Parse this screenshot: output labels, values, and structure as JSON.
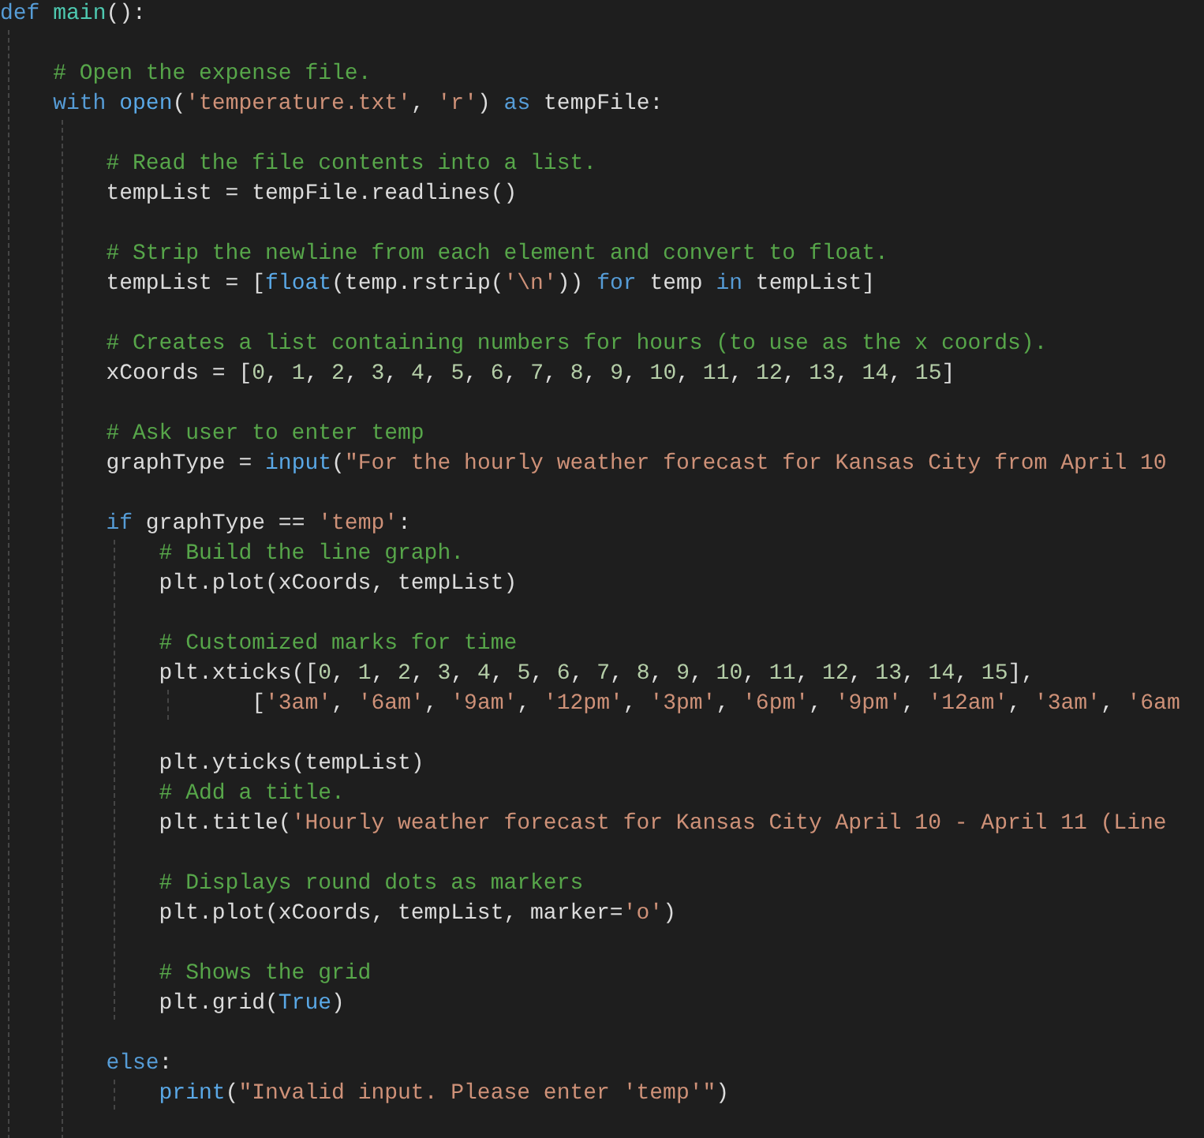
{
  "editor": {
    "lines": [
      {
        "kind": "code",
        "tokens": [
          {
            "kind": "keyword",
            "text": "def "
          },
          {
            "kind": "name",
            "text": "main"
          },
          {
            "kind": "plain",
            "text": "():"
          }
        ],
        "children": [
          {
            "kind": "blank"
          },
          {
            "kind": "code",
            "tokens": [
              {
                "kind": "comment",
                "text": "# Open the expense file."
              }
            ]
          },
          {
            "kind": "code",
            "tokens": [
              {
                "kind": "keyword",
                "text": "with "
              },
              {
                "kind": "builtin",
                "text": "open"
              },
              {
                "kind": "plain",
                "text": "("
              },
              {
                "kind": "string",
                "text": "'temperature.txt'"
              },
              {
                "kind": "plain",
                "text": ", "
              },
              {
                "kind": "string",
                "text": "'r'"
              },
              {
                "kind": "plain",
                "text": ") "
              },
              {
                "kind": "keyword",
                "text": "as"
              },
              {
                "kind": "plain",
                "text": " tempFile:"
              }
            ],
            "children": [
              {
                "kind": "blank"
              },
              {
                "kind": "code",
                "tokens": [
                  {
                    "kind": "comment",
                    "text": "# Read the file contents into a list."
                  }
                ]
              },
              {
                "kind": "code",
                "tokens": [
                  {
                    "kind": "plain",
                    "text": "tempList = tempFile.readlines()"
                  }
                ]
              },
              {
                "kind": "blank"
              },
              {
                "kind": "code",
                "tokens": [
                  {
                    "kind": "comment",
                    "text": "# Strip the newline from each element and convert to float."
                  }
                ]
              },
              {
                "kind": "code",
                "tokens": [
                  {
                    "kind": "plain",
                    "text": "tempList = ["
                  },
                  {
                    "kind": "builtin",
                    "text": "float"
                  },
                  {
                    "kind": "plain",
                    "text": "(temp.rstrip("
                  },
                  {
                    "kind": "string",
                    "text": "'\\n'"
                  },
                  {
                    "kind": "plain",
                    "text": ")) "
                  },
                  {
                    "kind": "keyword",
                    "text": "for"
                  },
                  {
                    "kind": "plain",
                    "text": " temp "
                  },
                  {
                    "kind": "keyword",
                    "text": "in"
                  },
                  {
                    "kind": "plain",
                    "text": " tempList]"
                  }
                ]
              },
              {
                "kind": "blank"
              },
              {
                "kind": "code",
                "tokens": [
                  {
                    "kind": "comment",
                    "text": "# Creates a list containing numbers for hours (to use as the x coords)."
                  }
                ]
              },
              {
                "kind": "code",
                "tokens": [
                  {
                    "kind": "plain",
                    "text": "xCoords = ["
                  },
                  {
                    "kind": "number",
                    "text": "0"
                  },
                  {
                    "kind": "plain",
                    "text": ", "
                  },
                  {
                    "kind": "number",
                    "text": "1"
                  },
                  {
                    "kind": "plain",
                    "text": ", "
                  },
                  {
                    "kind": "number",
                    "text": "2"
                  },
                  {
                    "kind": "plain",
                    "text": ", "
                  },
                  {
                    "kind": "number",
                    "text": "3"
                  },
                  {
                    "kind": "plain",
                    "text": ", "
                  },
                  {
                    "kind": "number",
                    "text": "4"
                  },
                  {
                    "kind": "plain",
                    "text": ", "
                  },
                  {
                    "kind": "number",
                    "text": "5"
                  },
                  {
                    "kind": "plain",
                    "text": ", "
                  },
                  {
                    "kind": "number",
                    "text": "6"
                  },
                  {
                    "kind": "plain",
                    "text": ", "
                  },
                  {
                    "kind": "number",
                    "text": "7"
                  },
                  {
                    "kind": "plain",
                    "text": ", "
                  },
                  {
                    "kind": "number",
                    "text": "8"
                  },
                  {
                    "kind": "plain",
                    "text": ", "
                  },
                  {
                    "kind": "number",
                    "text": "9"
                  },
                  {
                    "kind": "plain",
                    "text": ", "
                  },
                  {
                    "kind": "number",
                    "text": "10"
                  },
                  {
                    "kind": "plain",
                    "text": ", "
                  },
                  {
                    "kind": "number",
                    "text": "11"
                  },
                  {
                    "kind": "plain",
                    "text": ", "
                  },
                  {
                    "kind": "number",
                    "text": "12"
                  },
                  {
                    "kind": "plain",
                    "text": ", "
                  },
                  {
                    "kind": "number",
                    "text": "13"
                  },
                  {
                    "kind": "plain",
                    "text": ", "
                  },
                  {
                    "kind": "number",
                    "text": "14"
                  },
                  {
                    "kind": "plain",
                    "text": ", "
                  },
                  {
                    "kind": "number",
                    "text": "15"
                  },
                  {
                    "kind": "plain",
                    "text": "]"
                  }
                ]
              },
              {
                "kind": "blank"
              },
              {
                "kind": "code",
                "tokens": [
                  {
                    "kind": "comment",
                    "text": "# Ask user to enter temp"
                  }
                ]
              },
              {
                "kind": "code",
                "tokens": [
                  {
                    "kind": "plain",
                    "text": "graphType = "
                  },
                  {
                    "kind": "builtin",
                    "text": "input"
                  },
                  {
                    "kind": "plain",
                    "text": "("
                  },
                  {
                    "kind": "string",
                    "text": "\"For the hourly weather forecast for Kansas City from April 10"
                  }
                ]
              },
              {
                "kind": "blank"
              },
              {
                "kind": "code",
                "tokens": [
                  {
                    "kind": "keyword",
                    "text": "if"
                  },
                  {
                    "kind": "plain",
                    "text": " graphType == "
                  },
                  {
                    "kind": "string",
                    "text": "'temp'"
                  },
                  {
                    "kind": "plain",
                    "text": ":"
                  }
                ],
                "children": [
                  {
                    "kind": "code",
                    "tokens": [
                      {
                        "kind": "comment",
                        "text": "# Build the line graph."
                      }
                    ]
                  },
                  {
                    "kind": "code",
                    "tokens": [
                      {
                        "kind": "plain",
                        "text": "plt.plot(xCoords, tempList)"
                      }
                    ]
                  },
                  {
                    "kind": "blank"
                  },
                  {
                    "kind": "code",
                    "tokens": [
                      {
                        "kind": "comment",
                        "text": "# Customized marks for time"
                      }
                    ]
                  },
                  {
                    "kind": "code",
                    "tokens": [
                      {
                        "kind": "plain",
                        "text": "plt.xticks(["
                      },
                      {
                        "kind": "number",
                        "text": "0"
                      },
                      {
                        "kind": "plain",
                        "text": ", "
                      },
                      {
                        "kind": "number",
                        "text": "1"
                      },
                      {
                        "kind": "plain",
                        "text": ", "
                      },
                      {
                        "kind": "number",
                        "text": "2"
                      },
                      {
                        "kind": "plain",
                        "text": ", "
                      },
                      {
                        "kind": "number",
                        "text": "3"
                      },
                      {
                        "kind": "plain",
                        "text": ", "
                      },
                      {
                        "kind": "number",
                        "text": "4"
                      },
                      {
                        "kind": "plain",
                        "text": ", "
                      },
                      {
                        "kind": "number",
                        "text": "5"
                      },
                      {
                        "kind": "plain",
                        "text": ", "
                      },
                      {
                        "kind": "number",
                        "text": "6"
                      },
                      {
                        "kind": "plain",
                        "text": ", "
                      },
                      {
                        "kind": "number",
                        "text": "7"
                      },
                      {
                        "kind": "plain",
                        "text": ", "
                      },
                      {
                        "kind": "number",
                        "text": "8"
                      },
                      {
                        "kind": "plain",
                        "text": ", "
                      },
                      {
                        "kind": "number",
                        "text": "9"
                      },
                      {
                        "kind": "plain",
                        "text": ", "
                      },
                      {
                        "kind": "number",
                        "text": "10"
                      },
                      {
                        "kind": "plain",
                        "text": ", "
                      },
                      {
                        "kind": "number",
                        "text": "11"
                      },
                      {
                        "kind": "plain",
                        "text": ", "
                      },
                      {
                        "kind": "number",
                        "text": "12"
                      },
                      {
                        "kind": "plain",
                        "text": ", "
                      },
                      {
                        "kind": "number",
                        "text": "13"
                      },
                      {
                        "kind": "plain",
                        "text": ", "
                      },
                      {
                        "kind": "number",
                        "text": "14"
                      },
                      {
                        "kind": "plain",
                        "text": ", "
                      },
                      {
                        "kind": "number",
                        "text": "15"
                      },
                      {
                        "kind": "plain",
                        "text": "],"
                      }
                    ],
                    "children": [
                      {
                        "kind": "code",
                        "tokens": [
                          {
                            "kind": "plain",
                            "text": "   ["
                          },
                          {
                            "kind": "string",
                            "text": "'3am'"
                          },
                          {
                            "kind": "plain",
                            "text": ", "
                          },
                          {
                            "kind": "string",
                            "text": "'6am'"
                          },
                          {
                            "kind": "plain",
                            "text": ", "
                          },
                          {
                            "kind": "string",
                            "text": "'9am'"
                          },
                          {
                            "kind": "plain",
                            "text": ", "
                          },
                          {
                            "kind": "string",
                            "text": "'12pm'"
                          },
                          {
                            "kind": "plain",
                            "text": ", "
                          },
                          {
                            "kind": "string",
                            "text": "'3pm'"
                          },
                          {
                            "kind": "plain",
                            "text": ", "
                          },
                          {
                            "kind": "string",
                            "text": "'6pm'"
                          },
                          {
                            "kind": "plain",
                            "text": ", "
                          },
                          {
                            "kind": "string",
                            "text": "'9pm'"
                          },
                          {
                            "kind": "plain",
                            "text": ", "
                          },
                          {
                            "kind": "string",
                            "text": "'12am'"
                          },
                          {
                            "kind": "plain",
                            "text": ", "
                          },
                          {
                            "kind": "string",
                            "text": "'3am'"
                          },
                          {
                            "kind": "plain",
                            "text": ", "
                          },
                          {
                            "kind": "string",
                            "text": "'6am"
                          }
                        ]
                      }
                    ]
                  },
                  {
                    "kind": "blank"
                  },
                  {
                    "kind": "code",
                    "tokens": [
                      {
                        "kind": "plain",
                        "text": "plt.yticks(tempList)"
                      }
                    ]
                  },
                  {
                    "kind": "code",
                    "tokens": [
                      {
                        "kind": "comment",
                        "text": "# Add a title."
                      }
                    ]
                  },
                  {
                    "kind": "code",
                    "tokens": [
                      {
                        "kind": "plain",
                        "text": "plt.title("
                      },
                      {
                        "kind": "string",
                        "text": "'Hourly weather forecast for Kansas City April 10 - April 11 (Line"
                      }
                    ]
                  },
                  {
                    "kind": "blank"
                  },
                  {
                    "kind": "code",
                    "tokens": [
                      {
                        "kind": "comment",
                        "text": "# Displays round dots as markers"
                      }
                    ]
                  },
                  {
                    "kind": "code",
                    "tokens": [
                      {
                        "kind": "plain",
                        "text": "plt.plot(xCoords, tempList, marker="
                      },
                      {
                        "kind": "string",
                        "text": "'o'"
                      },
                      {
                        "kind": "plain",
                        "text": ")"
                      }
                    ]
                  },
                  {
                    "kind": "blank"
                  },
                  {
                    "kind": "code",
                    "tokens": [
                      {
                        "kind": "comment",
                        "text": "# Shows the grid"
                      }
                    ]
                  },
                  {
                    "kind": "code",
                    "tokens": [
                      {
                        "kind": "plain",
                        "text": "plt.grid("
                      },
                      {
                        "kind": "builtin",
                        "text": "True"
                      },
                      {
                        "kind": "plain",
                        "text": ")"
                      }
                    ]
                  }
                ]
              },
              {
                "kind": "blank"
              },
              {
                "kind": "code",
                "tokens": [
                  {
                    "kind": "keyword",
                    "text": "else"
                  },
                  {
                    "kind": "plain",
                    "text": ":"
                  }
                ],
                "children": [
                  {
                    "kind": "code",
                    "tokens": [
                      {
                        "kind": "builtin",
                        "text": "print"
                      },
                      {
                        "kind": "plain",
                        "text": "("
                      },
                      {
                        "kind": "string",
                        "text": "\"Invalid input. Please enter 'temp'\""
                      },
                      {
                        "kind": "plain",
                        "text": ")"
                      }
                    ]
                  }
                ]
              },
              {
                "kind": "blank"
              }
            ]
          }
        ]
      }
    ]
  }
}
